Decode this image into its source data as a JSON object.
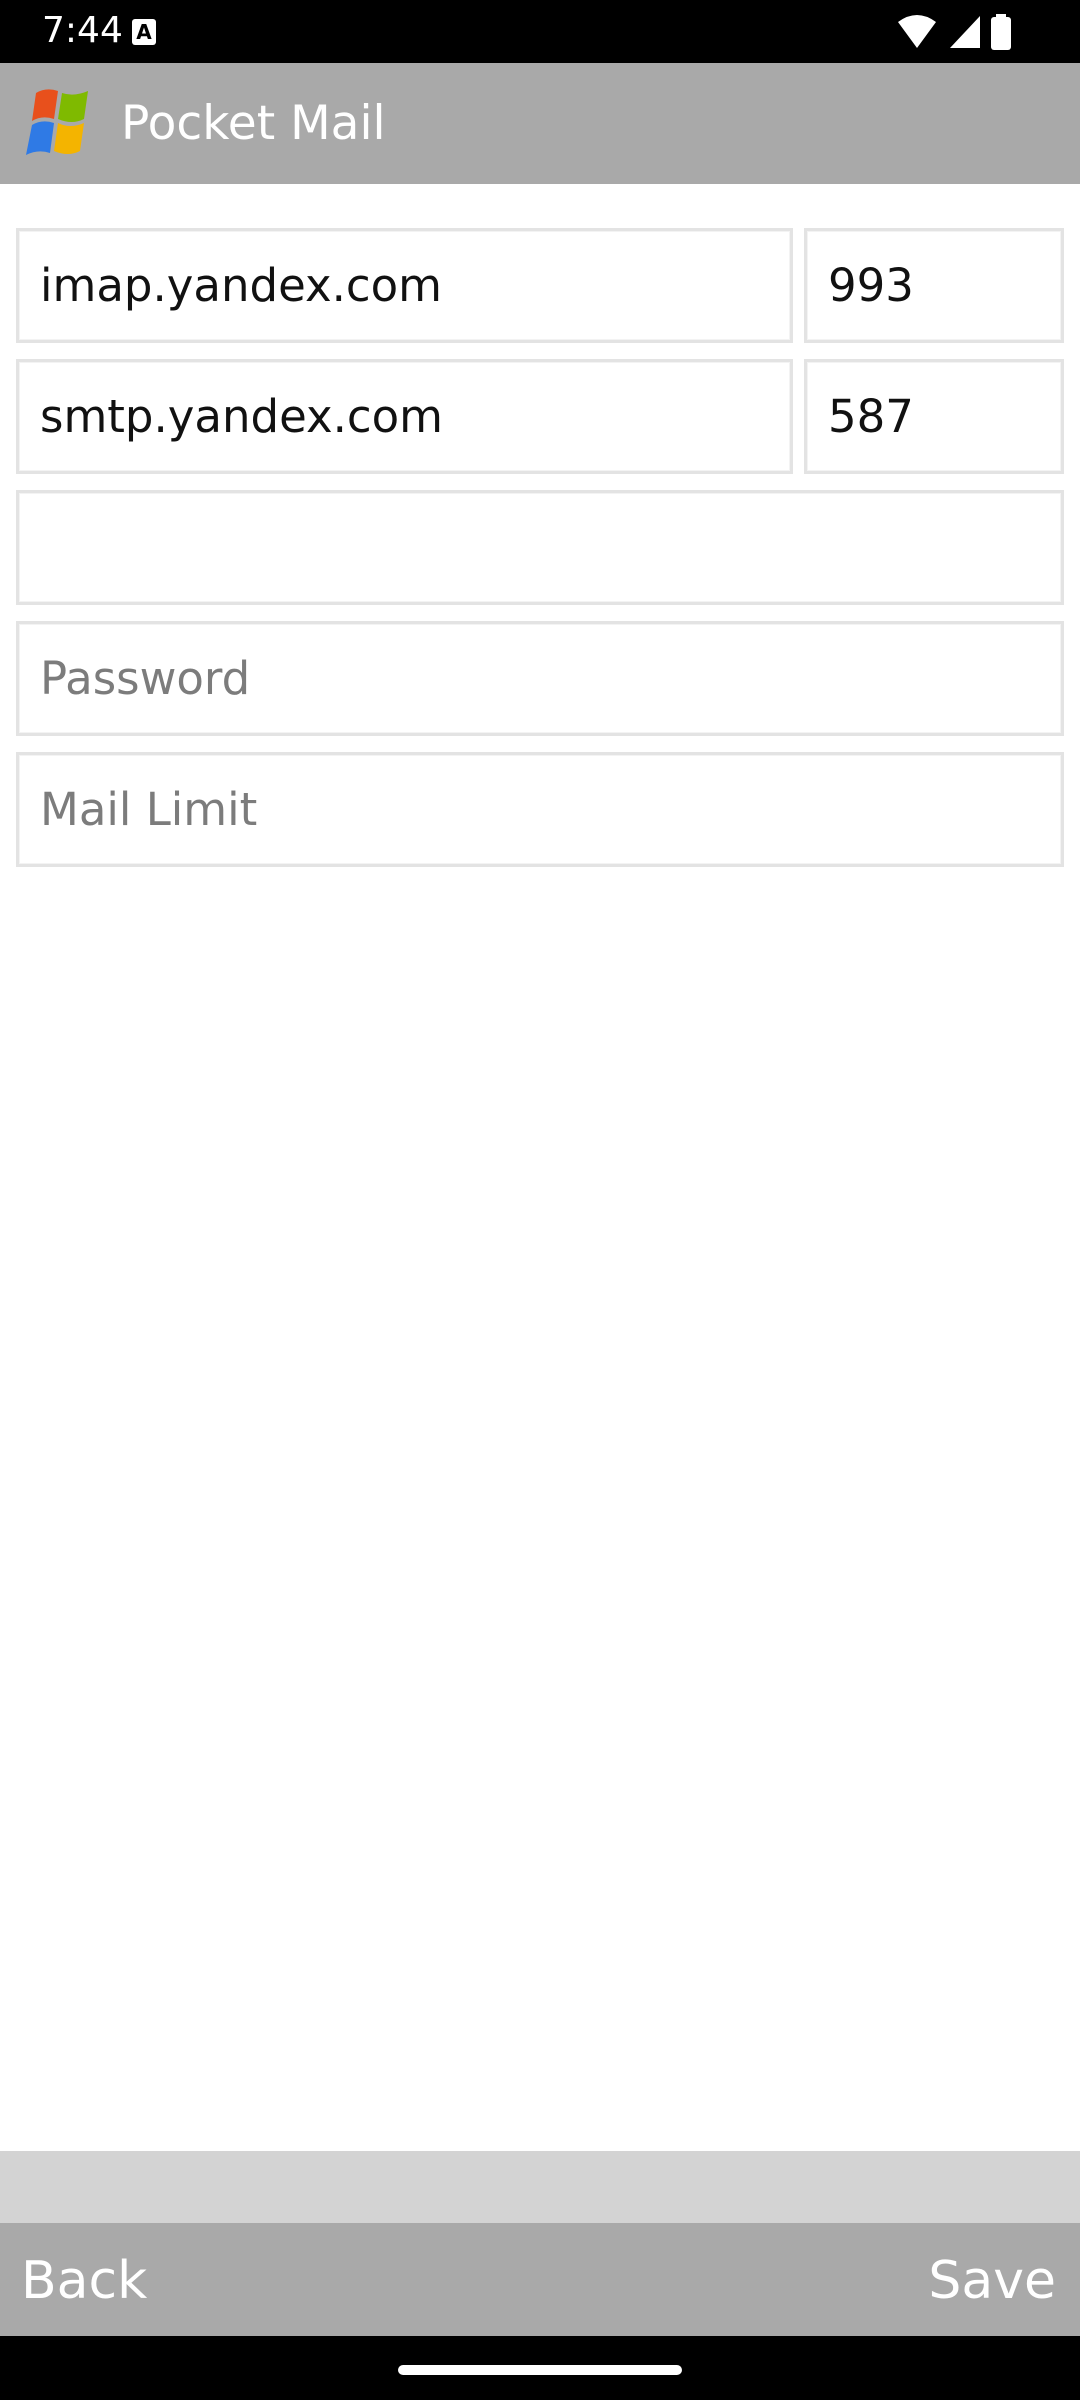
{
  "status_bar": {
    "time": "7:44",
    "notification_icon": "a-icon",
    "icons": [
      "wifi-icon",
      "signal-icon",
      "battery-icon"
    ]
  },
  "app_bar": {
    "title": "Pocket Mail",
    "logo_icon": "windows-logo-icon"
  },
  "form": {
    "imap_server": {
      "value": "imap.yandex.com",
      "placeholder": ""
    },
    "imap_port": {
      "value": "993",
      "placeholder": ""
    },
    "smtp_server": {
      "value": "smtp.yandex.com",
      "placeholder": ""
    },
    "smtp_port": {
      "value": "587",
      "placeholder": ""
    },
    "email": {
      "value": "",
      "placeholder": ""
    },
    "password": {
      "value": "",
      "placeholder": "Password"
    },
    "mail_limit": {
      "value": "",
      "placeholder": "Mail Limit"
    }
  },
  "bottom_bar": {
    "back_label": "Back",
    "save_label": "Save"
  },
  "colors": {
    "app_bar": "#a9a9a9",
    "bottom_divider": "#d3d3d3",
    "field_border": "#e3e3e3",
    "placeholder_text": "#7c7c7c"
  }
}
